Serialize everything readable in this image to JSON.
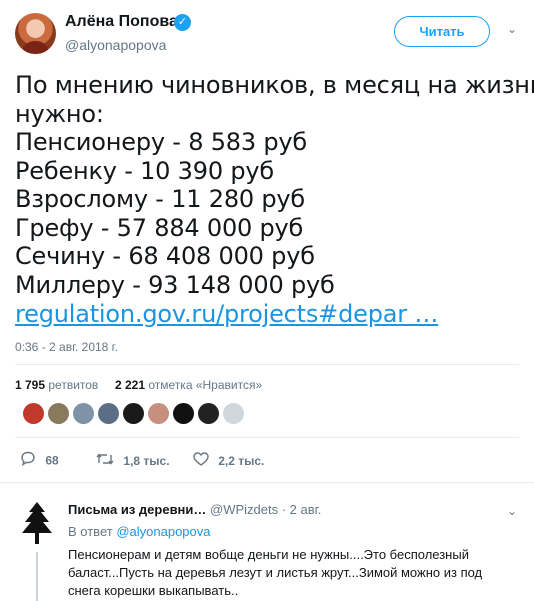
{
  "author": {
    "name": "Алёна Попова",
    "handle": "@alyonapopova",
    "verified_icon": "✓"
  },
  "follow_button": {
    "label": "Читать"
  },
  "menu_icon": "⌄",
  "tweet": {
    "lines": [
      "По мнению чиновников, в месяц на жизнь",
      "нужно:",
      "Пенсионеру - 8 583 руб",
      "Ребенку - 10 390 руб",
      "Взрослому - 11 280 руб",
      "Грефу - 57 884 000 руб",
      "Сечину - 68 408 000 руб",
      "Миллеру - 93 148 000 руб"
    ],
    "link": "regulation.gov.ru/projects#depar …",
    "timestamp": "0:36 - 2 авг. 2018 г."
  },
  "stats": {
    "retweets_count": "1 795",
    "retweets_label": "ретвитов",
    "likes_count": "2 221",
    "likes_label": "отметка «Нравится»"
  },
  "liker_colors": [
    "#c0392b",
    "#8a7a5c",
    "#7e93a8",
    "#5a6f86",
    "#1a1a1a",
    "#c98f7e",
    "#111111",
    "#222222",
    "#cfd6dc"
  ],
  "actions": {
    "reply_icon": "💬",
    "reply_count": "68",
    "retweet_icon": "⟲",
    "retweet_count": "1,8 тыс.",
    "like_icon": "♡",
    "like_count": "2,2 тыс."
  },
  "reply": {
    "name": "Письма из деревни…",
    "handle_date": "@WPizdets · 2 авг.",
    "reply_to_prefix": "В ответ",
    "reply_to_mention": "@alyonapopova",
    "text": "Пенсионерам и детям вобще деньги не нужны....Это бесполезный баласт...Пусть на деревья лезут и листья жрут...Зимой можно из под снега корешки выкапывать..",
    "menu_icon": "⌄"
  }
}
